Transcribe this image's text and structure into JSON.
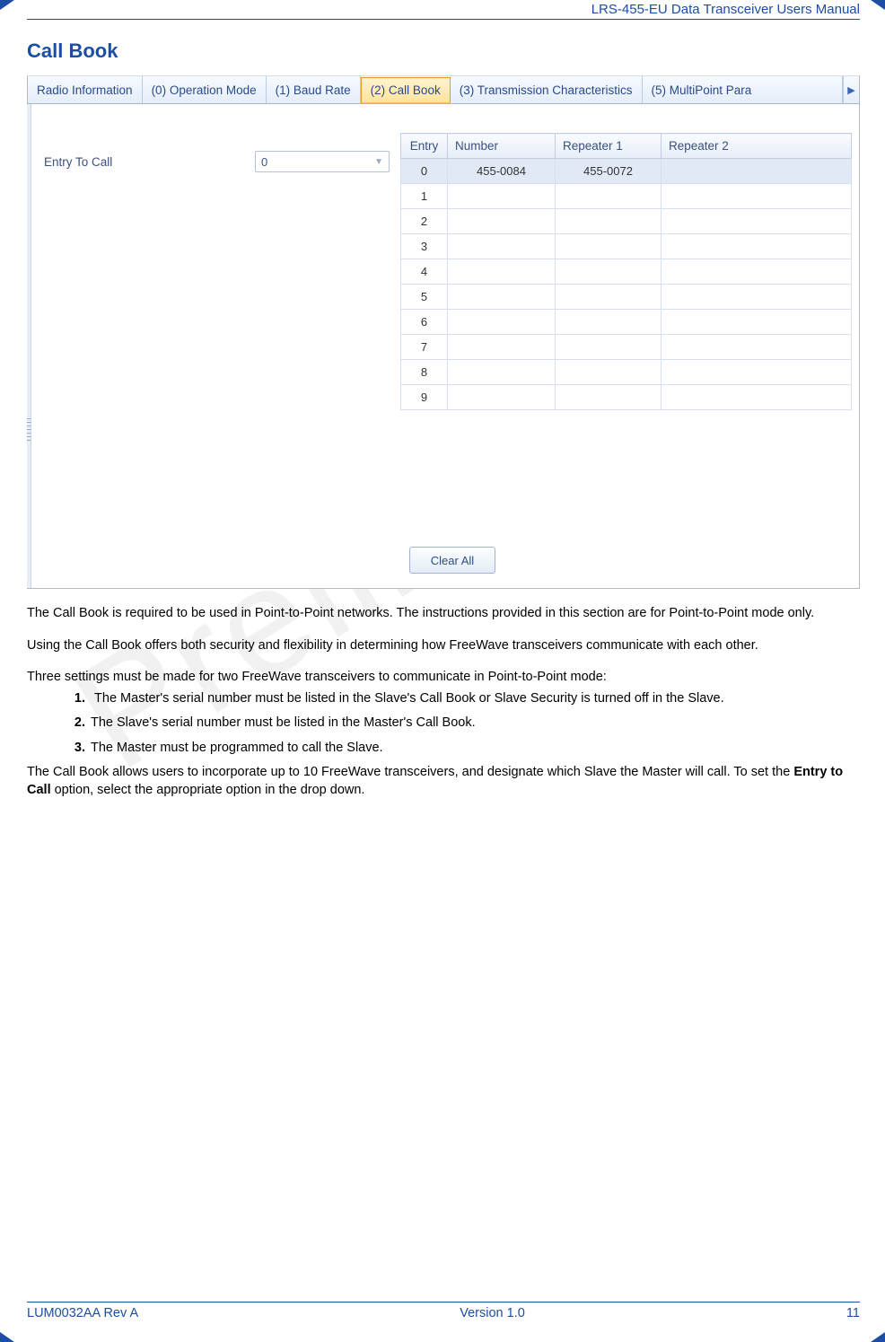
{
  "header": {
    "doc_title": "LRS-455-EU Data Transceiver Users Manual"
  },
  "section": {
    "title": "Call Book"
  },
  "watermark": "Prelim",
  "ui": {
    "tabs": [
      {
        "label": "Radio Information",
        "active": false
      },
      {
        "label": "(0) Operation Mode",
        "active": false
      },
      {
        "label": "(1) Baud Rate",
        "active": false
      },
      {
        "label": "(2) Call Book",
        "active": true
      },
      {
        "label": "(3) Transmission Characteristics",
        "active": false
      },
      {
        "label": "(5) MultiPoint Para",
        "active": false
      }
    ],
    "scroll_arrow": "▶",
    "entry_to_call_label": "Entry To Call",
    "entry_to_call_value": "0",
    "table": {
      "columns": [
        "Entry",
        "Number",
        "Repeater 1",
        "Repeater 2"
      ],
      "rows": [
        {
          "entry": "0",
          "number": "455-0084",
          "repeater1": "455-0072",
          "repeater2": "",
          "selected": true
        },
        {
          "entry": "1",
          "number": "",
          "repeater1": "",
          "repeater2": ""
        },
        {
          "entry": "2",
          "number": "",
          "repeater1": "",
          "repeater2": ""
        },
        {
          "entry": "3",
          "number": "",
          "repeater1": "",
          "repeater2": ""
        },
        {
          "entry": "4",
          "number": "",
          "repeater1": "",
          "repeater2": ""
        },
        {
          "entry": "5",
          "number": "",
          "repeater1": "",
          "repeater2": ""
        },
        {
          "entry": "6",
          "number": "",
          "repeater1": "",
          "repeater2": ""
        },
        {
          "entry": "7",
          "number": "",
          "repeater1": "",
          "repeater2": ""
        },
        {
          "entry": "8",
          "number": "",
          "repeater1": "",
          "repeater2": ""
        },
        {
          "entry": "9",
          "number": "",
          "repeater1": "",
          "repeater2": ""
        }
      ]
    },
    "clear_all_label": "Clear All"
  },
  "body": {
    "p1": "The Call Book is required to be used in Point-to-Point networks. The instructions provided in this section are for Point-to-Point mode only.",
    "p2": "Using the Call Book offers both security and flexibility in determining how FreeWave transceivers communicate with each other.",
    "p3_intro": "Three settings must be made for two FreeWave transceivers to communicate in Point-to-Point mode:",
    "li1": "The Master's serial number must be listed in the Slave's Call Book or Slave Security is turned off in the Slave.",
    "li2": "The Slave's serial number must be listed in the Master's Call Book.",
    "li3": "The Master must be programmed to call the Slave.",
    "p4_a": "The Call Book allows users to incorporate up to 10 FreeWave transceivers, and designate which Slave the Master will call.  To set the ",
    "p4_bold": "Entry to Call",
    "p4_b": " option, select the appropriate option in the drop down."
  },
  "footer": {
    "left": "LUM0032AA Rev A",
    "center": "Version 1.0",
    "right": "11"
  }
}
